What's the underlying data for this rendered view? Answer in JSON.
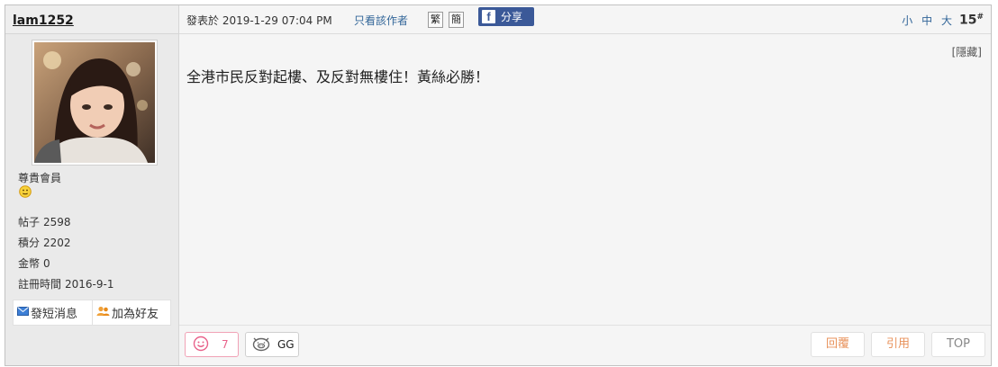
{
  "user": {
    "name": "lam1252",
    "rank": "尊貴會員",
    "rank_icon": "smiley-face-icon",
    "stats": [
      {
        "label": "帖子",
        "value": "2598"
      },
      {
        "label": "積分",
        "value": "2202"
      },
      {
        "label": "金幣",
        "value": "0"
      },
      {
        "label": "註冊時間",
        "value": "2016-9-1"
      }
    ],
    "pm_label": "發短消息",
    "add_friend_label": "加為好友"
  },
  "post": {
    "time": "發表於 2019-1-29 07:04 PM",
    "only_author": "只看該作者",
    "trad": "繁",
    "simp": "簡",
    "share": "分享",
    "font_small": "小",
    "font_medium": "中",
    "font_large": "大",
    "floor": "15",
    "floor_mark": "#",
    "hide": "[隱藏]",
    "content": "全港市民反對起樓、及反對無樓住！黃絲必勝！"
  },
  "actions": {
    "like_count": "7",
    "gg_label": "GG",
    "reply": "回覆",
    "quote": "引用",
    "top": "TOP"
  },
  "colors": {
    "link": "#336699",
    "facebook": "#3b5998",
    "accent_orange": "#e8925b",
    "like_pink": "#e8628a"
  }
}
